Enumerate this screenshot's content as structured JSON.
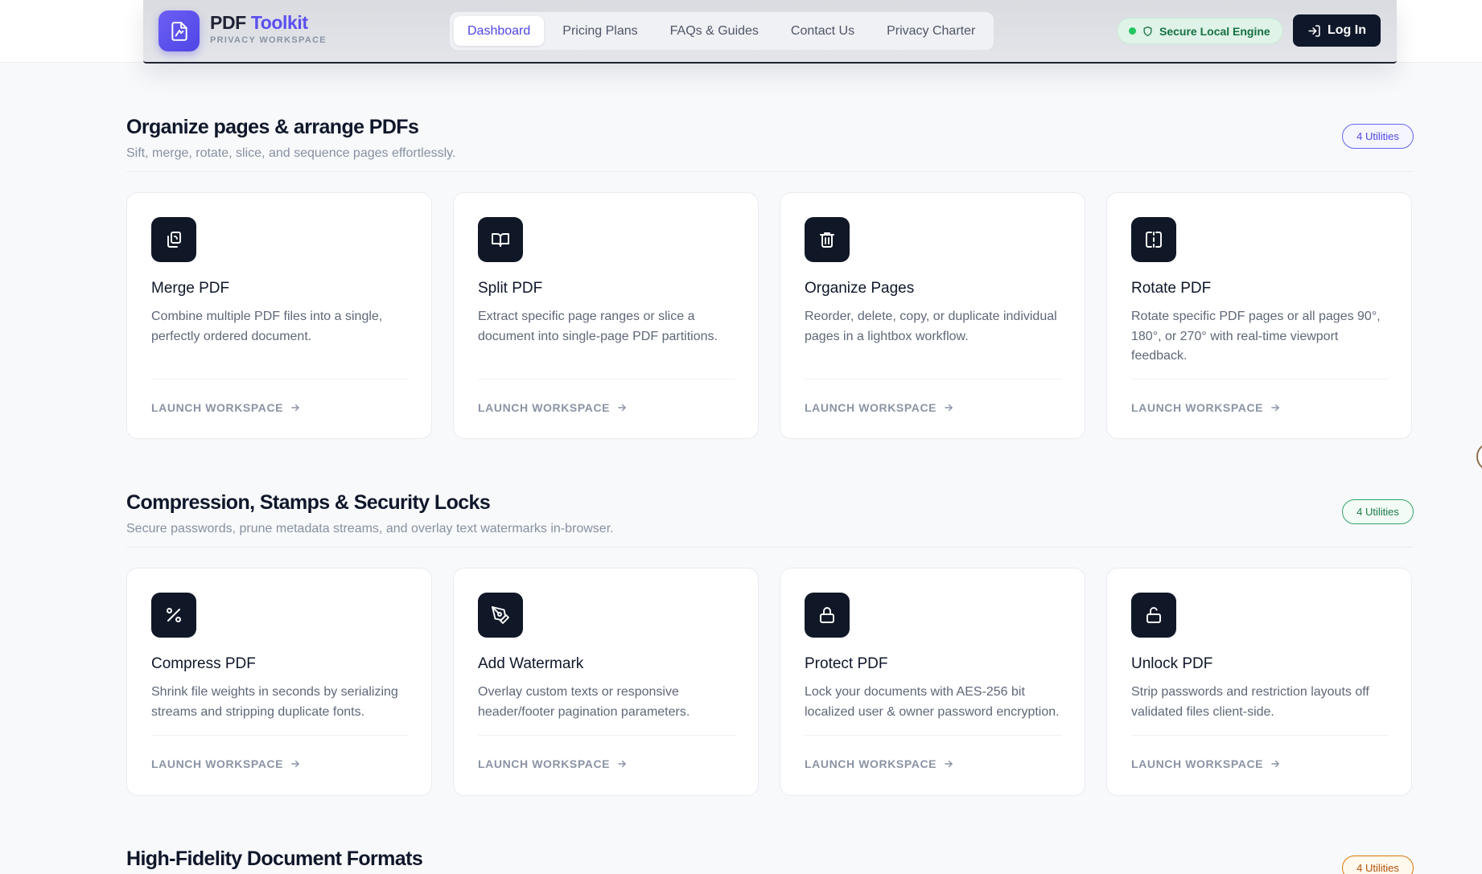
{
  "header": {
    "brand_name_part1": "PDF",
    "brand_name_part2": "Toolkit",
    "brand_sub": "PRIVACY WORKSPACE",
    "nav": [
      {
        "label": "Dashboard",
        "active": true
      },
      {
        "label": "Pricing Plans",
        "active": false
      },
      {
        "label": "FAQs & Guides",
        "active": false
      },
      {
        "label": "Contact Us",
        "active": false
      },
      {
        "label": "Privacy Charter",
        "active": false
      }
    ],
    "secure_badge": "Secure Local Engine",
    "login_label": "Log In"
  },
  "sections": [
    {
      "title": "Organize pages & arrange PDFs",
      "subtitle": "Sift, merge, rotate, slice, and sequence pages effortlessly.",
      "badge": "4 Utilities",
      "badge_color": "#4f46e5",
      "cards": [
        {
          "title": "Merge PDF",
          "desc": "Combine multiple PDF files into a single, perfectly ordered document.",
          "icon": "merge-icon",
          "launch": "LAUNCH WORKSPACE"
        },
        {
          "title": "Split PDF",
          "desc": "Extract specific page ranges or slice a document into single-page PDF partitions.",
          "icon": "book-open-icon",
          "launch": "LAUNCH WORKSPACE"
        },
        {
          "title": "Organize Pages",
          "desc": "Reorder, delete, copy, or duplicate individual pages in a lightbox workflow.",
          "icon": "trash-icon",
          "launch": "LAUNCH WORKSPACE"
        },
        {
          "title": "Rotate PDF",
          "desc": "Rotate specific PDF pages or all pages 90°, 180°, or 270° with real-time viewport feedback.",
          "icon": "split-frame-icon",
          "launch": "LAUNCH WORKSPACE"
        }
      ]
    },
    {
      "title": "Compression, Stamps & Security Locks",
      "subtitle": "Secure passwords, prune metadata streams, and overlay text watermarks in-browser.",
      "badge": "4 Utilities",
      "badge_color": "#1b7a46",
      "cards": [
        {
          "title": "Compress PDF",
          "desc": "Shrink file weights in seconds by serializing streams and stripping duplicate fonts.",
          "icon": "percent-icon",
          "launch": "LAUNCH WORKSPACE"
        },
        {
          "title": "Add Watermark",
          "desc": "Overlay custom texts or responsive header/footer pagination parameters.",
          "icon": "pen-tool-icon",
          "launch": "LAUNCH WORKSPACE"
        },
        {
          "title": "Protect PDF",
          "desc": "Lock your documents with AES-256 bit localized user & owner password encryption.",
          "icon": "lock-icon",
          "launch": "LAUNCH WORKSPACE"
        },
        {
          "title": "Unlock PDF",
          "desc": "Strip passwords and restriction layouts off validated files client-side.",
          "icon": "unlock-icon",
          "launch": "LAUNCH WORKSPACE"
        }
      ]
    },
    {
      "title": "High-Fidelity Document Formats",
      "badge": "4 Utilities",
      "badge_color": "#b45309"
    }
  ]
}
